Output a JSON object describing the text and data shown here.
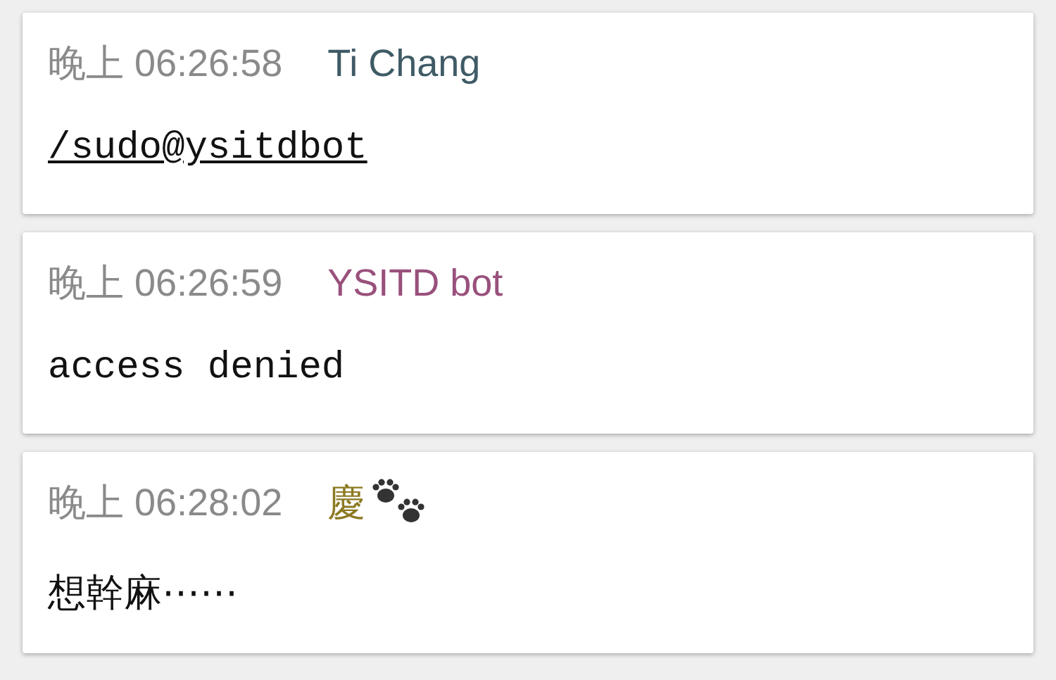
{
  "messages": [
    {
      "time": "晚上 06:26:58",
      "sender": "Ti Chang",
      "color": "#3f5b66",
      "paws": false,
      "kind": "link",
      "text": "/sudo@ysitdbot"
    },
    {
      "time": "晚上 06:26:59",
      "sender": "YSITD bot",
      "color": "#99507c",
      "paws": false,
      "kind": "code",
      "text": "access denied"
    },
    {
      "time": "晚上 06:28:02",
      "sender": "慶",
      "color": "#8c7a22",
      "paws": true,
      "kind": "text",
      "text": "想幹麻⋯⋯"
    }
  ]
}
